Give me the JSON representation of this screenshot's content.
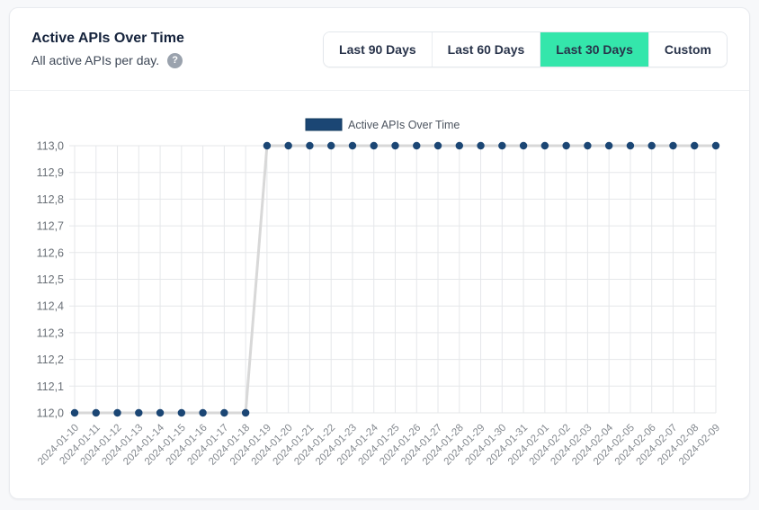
{
  "page": {
    "background": "#f7f8fa"
  },
  "header": {
    "title": "Active APIs Over Time",
    "subtitle": "All active APIs per day.",
    "help_icon": "?",
    "range_buttons": [
      {
        "label": "Last 90 Days",
        "active": false
      },
      {
        "label": "Last 60 Days",
        "active": false
      },
      {
        "label": "Last 30 Days",
        "active": true
      },
      {
        "label": "Custom",
        "active": false
      }
    ],
    "active_button_color": "#34e6ab",
    "button_text_color": "#28334a"
  },
  "chart_data": {
    "type": "line",
    "title": "Active APIs Over Time",
    "legend": {
      "label": "Active APIs Over Time",
      "swatch_color": "#1b4674",
      "swatch_border": "#12395e",
      "position": "top-center"
    },
    "x": [
      "2024-01-10",
      "2024-01-11",
      "2024-01-12",
      "2024-01-13",
      "2024-01-14",
      "2024-01-15",
      "2024-01-16",
      "2024-01-17",
      "2024-01-18",
      "2024-01-19",
      "2024-01-20",
      "2024-01-21",
      "2024-01-22",
      "2024-01-23",
      "2024-01-24",
      "2024-01-25",
      "2024-01-26",
      "2024-01-27",
      "2024-01-28",
      "2024-01-29",
      "2024-01-30",
      "2024-01-31",
      "2024-02-01",
      "2024-02-02",
      "2024-02-03",
      "2024-02-04",
      "2024-02-05",
      "2024-02-06",
      "2024-02-07",
      "2024-02-08",
      "2024-02-09"
    ],
    "series": [
      {
        "name": "Active APIs Over Time",
        "values": [
          112,
          112,
          112,
          112,
          112,
          112,
          112,
          112,
          112,
          113,
          113,
          113,
          113,
          113,
          113,
          113,
          113,
          113,
          113,
          113,
          113,
          113,
          113,
          113,
          113,
          113,
          113,
          113,
          113,
          113,
          113
        ]
      }
    ],
    "ylim": [
      112.0,
      113.0
    ],
    "y_tick_step": 0.1,
    "y_tick_labels": [
      "112,0",
      "112,1",
      "112,2",
      "112,3",
      "112,4",
      "112,5",
      "112,6",
      "112,7",
      "112,8",
      "112,9",
      "113,0"
    ],
    "decimal_separator": ",",
    "grid": true,
    "grid_color": "#e5e7ea",
    "line_color": "#d8d8d8",
    "point_color": "#1b4674",
    "y_label_color": "#6a7077",
    "x_label_color": "#84898f",
    "legend_text_color": "#4d5560"
  }
}
